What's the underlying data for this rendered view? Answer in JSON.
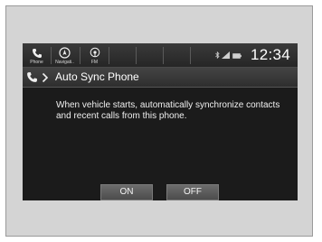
{
  "statusbar": {
    "buttons": [
      {
        "label": "Phone",
        "icon": "phone-icon"
      },
      {
        "label": "Navigati..",
        "icon": "navigation-icon"
      },
      {
        "label": "FM",
        "icon": "radio-icon"
      }
    ],
    "indicators": [
      "bluetooth-icon",
      "signal-strength-icon",
      "battery-icon"
    ],
    "clock": "12:34"
  },
  "header": {
    "back_icon": "phone-icon",
    "separator_icon": "chevron-right-icon",
    "title": "Auto Sync Phone"
  },
  "dialog": {
    "message": "When vehicle starts, automatically synchronize contacts and recent calls from this phone.",
    "buttons": {
      "on": "ON",
      "off": "OFF"
    }
  },
  "colors": {
    "screen_background": "#1b1b1b",
    "button_background": "#5c5c5c",
    "text": "#ffffff"
  }
}
